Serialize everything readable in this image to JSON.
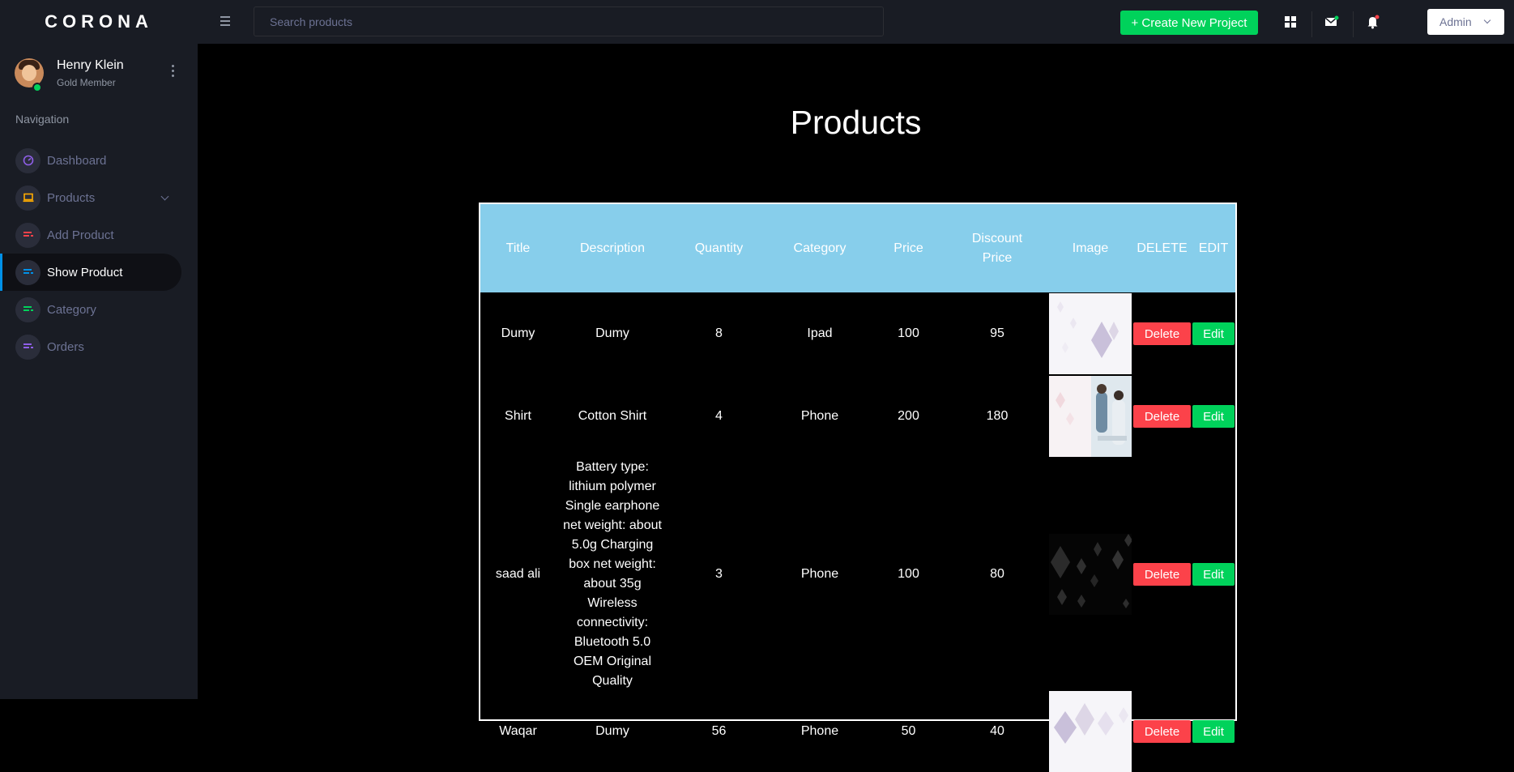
{
  "brand": "CORONA",
  "profile": {
    "name": "Henry Klein",
    "role": "Gold Member"
  },
  "navigation": {
    "heading": "Navigation",
    "items": [
      {
        "label": "Dashboard",
        "icon": "speedometer-icon",
        "color": "#8f5fe8"
      },
      {
        "label": "Products",
        "icon": "laptop-icon",
        "color": "#ffab00"
      },
      {
        "label": "Add Product",
        "icon": "list-icon",
        "color": "#fc424a"
      },
      {
        "label": "Show Product",
        "icon": "list-icon",
        "color": "#0090e7"
      },
      {
        "label": "Category",
        "icon": "list-icon",
        "color": "#00d25b"
      },
      {
        "label": "Orders",
        "icon": "list-icon",
        "color": "#8f5fe8"
      }
    ],
    "active": "Show Product"
  },
  "topbar": {
    "search_placeholder": "Search products",
    "create_button": "+ Create New Project",
    "icons": [
      "grid-icon",
      "mail-icon",
      "bell-icon"
    ],
    "user_menu": "Admin"
  },
  "page": {
    "title": "Products",
    "table": {
      "headers": [
        "Title",
        "Description",
        "Quantity",
        "Category",
        "Price",
        "Discount Price",
        "Image",
        "DELETE",
        "EDIT"
      ],
      "delete_label": "Delete",
      "edit_label": "Edit",
      "rows": [
        {
          "title": "Dumy",
          "description": "Dumy",
          "quantity": "8",
          "category": "Ipad",
          "price": "100",
          "discount": "95"
        },
        {
          "title": "Shirt",
          "description": "Cotton Shirt",
          "quantity": "4",
          "category": "Phone",
          "price": "200",
          "discount": "180"
        },
        {
          "title": "saad ali",
          "description": "Battery type: lithium polymer Single earphone net weight: about 5.0g Charging box net weight: about 35g Wireless connectivity: Bluetooth 5.0 OEM Original Quality",
          "quantity": "3",
          "category": "Phone",
          "price": "100",
          "discount": "80"
        },
        {
          "title": "Waqar",
          "description": "Dumy",
          "quantity": "56",
          "category": "Phone",
          "price": "50",
          "discount": "40"
        }
      ]
    }
  },
  "colors": {
    "sidebar_bg": "#191c24",
    "header_bg": "#87ceeb",
    "success": "#00d25b",
    "danger": "#fc424a",
    "active_bar": "#0090e7"
  }
}
